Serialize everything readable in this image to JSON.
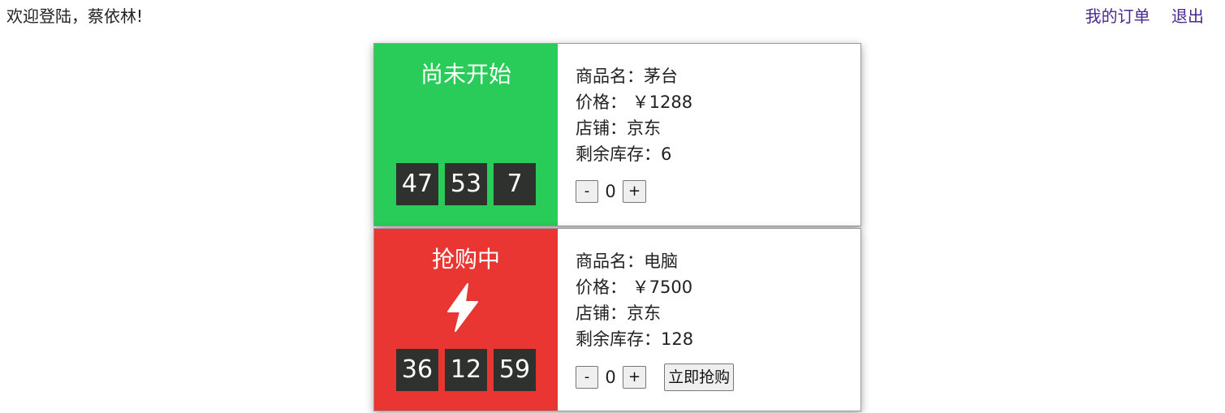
{
  "header": {
    "welcome": "欢迎登陆，蔡依林!",
    "my_orders": "我的订单",
    "logout": "退出"
  },
  "products": [
    {
      "status": "尚未开始",
      "status_color": "#29cb59",
      "countdown": [
        "47",
        "53",
        "7"
      ],
      "name_label": "商品名：茅台",
      "price_label": "价格： ￥1288",
      "shop_label": "店铺：京东",
      "stock_label": "剩余库存：6",
      "qty": "0",
      "minus": "-",
      "plus": "+"
    },
    {
      "status": "抢购中",
      "status_color": "#e93633",
      "icon": "lightning-icon",
      "countdown": [
        "36",
        "12",
        "59"
      ],
      "name_label": "商品名：电脑",
      "price_label": "价格： ￥7500",
      "shop_label": "店铺：京东",
      "stock_label": "剩余库存：128",
      "qty": "0",
      "minus": "-",
      "plus": "+",
      "buy_label": "立即抢购"
    }
  ]
}
